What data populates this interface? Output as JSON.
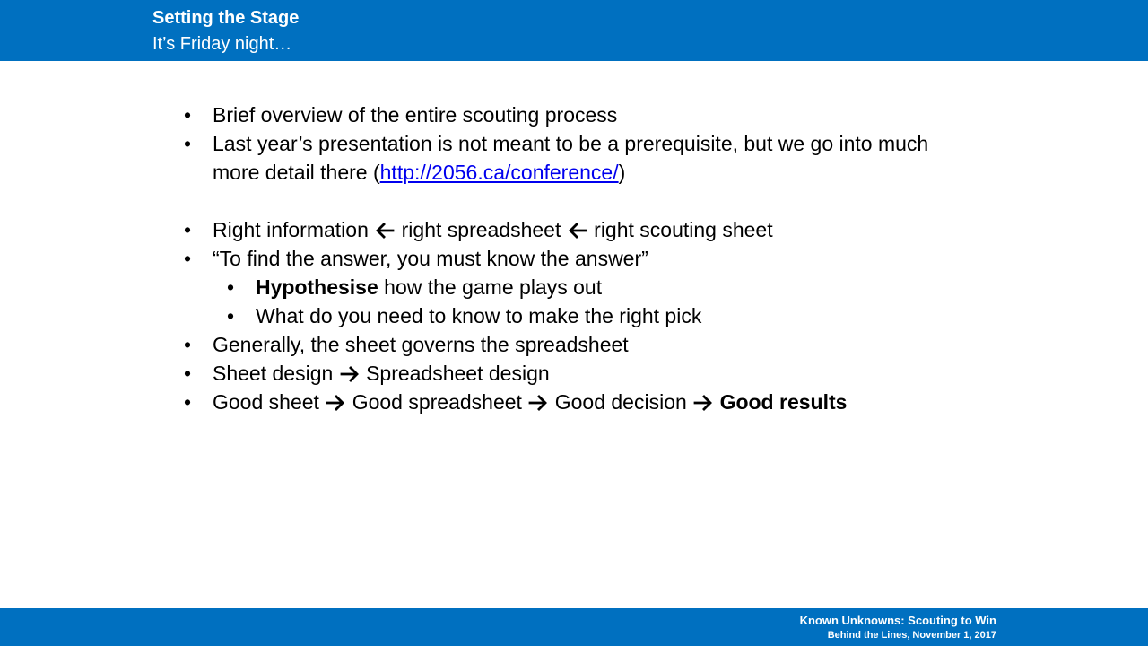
{
  "header": {
    "title": "Setting the Stage",
    "subtitle": "It’s Friday night…"
  },
  "bullets": {
    "b1": "Brief overview of the entire scouting process",
    "b2_prefix": "Last year’s presentation is not meant to be a prerequisite, but we go into much more detail there (",
    "b2_link": "http://2056.ca/conference/",
    "b2_suffix": ")",
    "b3_part1": "Right information",
    "b3_part2": "right spreadsheet",
    "b3_part3": "right scouting sheet",
    "b4": "“To find the answer, you must know the answer”",
    "b4a_bold": "Hypothesise",
    "b4a_rest": " how the game plays out",
    "b4b": "What do you need to know to make the right pick",
    "b5": "Generally, the sheet governs the spreadsheet",
    "b6_part1": "Sheet design",
    "b6_part2": "Spreadsheet design",
    "b7_part1": "Good sheet",
    "b7_part2": "Good spreadsheet",
    "b7_part3": "Good decision",
    "b7_bold": "Good results",
    "bullet_glyph": "•",
    "arrow_left": "🡐",
    "arrow_right": "🡒"
  },
  "footer": {
    "line1": "Known Unknowns: Scouting to Win",
    "line2": "Behind the Lines, November 1, 2017"
  },
  "colors": {
    "brand_blue": "#0070c0",
    "link_blue": "#0000ee"
  }
}
